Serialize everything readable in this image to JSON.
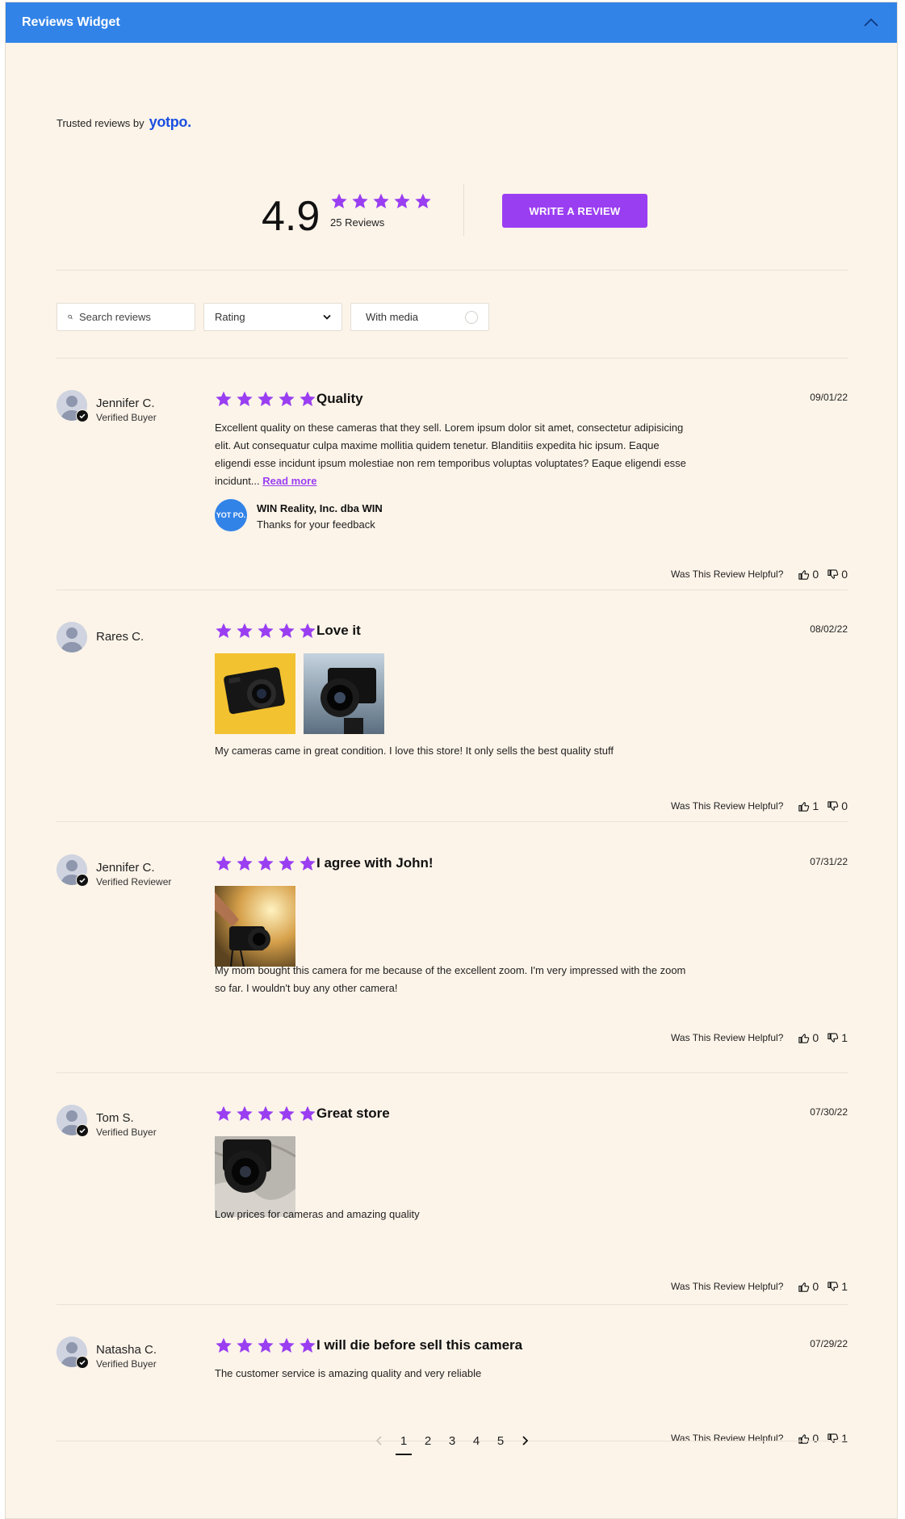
{
  "header": {
    "title": "Reviews Widget"
  },
  "branding": {
    "trusted_text": "Trusted reviews by",
    "logo_text": "yotpo."
  },
  "summary": {
    "average": "4.9",
    "count_text": "25 Reviews",
    "stars": 5,
    "write_button": "WRITE A REVIEW"
  },
  "filters": {
    "search_placeholder": "Search reviews",
    "rating_label": "Rating",
    "media_label": "With media"
  },
  "colors": {
    "header": "#3283e8",
    "accent": "#9a3ef2",
    "background": "#fdf4e9",
    "logo": "#1a4fe0"
  },
  "helpful_label": "Was This Review Helpful?",
  "reviews": [
    {
      "name": "Jennifer C.",
      "badge": "Verified Buyer",
      "title": "Quality",
      "date": "09/01/22",
      "stars": 5,
      "body": "Excellent quality on these cameras that they sell. Lorem ipsum dolor sit amet, consectetur adipisicing elit. Aut consequatur culpa maxime mollitia quidem tenetur. Blanditiis expedita hic ipsum. Eaque eligendi esse incidunt ipsum molestiae non rem temporibus voluptas voluptates? Eaque eligendi esse incidunt...",
      "read_more": "Read more",
      "reply": {
        "name": "WIN Reality, Inc. dba WIN",
        "text": "Thanks for your feedback",
        "logo": "YOT PO."
      },
      "up": "0",
      "down": "0"
    },
    {
      "name": "Rares C.",
      "badge": "",
      "title": "Love it",
      "date": "08/02/22",
      "stars": 5,
      "media": [
        "camera-on-yellow-photo",
        "lens-closeup-photo"
      ],
      "body": "My cameras came in great condition. I love this store! It only sells the best quality stuff",
      "up": "1",
      "down": "0"
    },
    {
      "name": "Jennifer C.",
      "badge": "Verified Reviewer",
      "title": "I agree with John!",
      "date": "07/31/22",
      "stars": 5,
      "media": [
        "hand-holding-camera-photo"
      ],
      "body": "My mom bought this camera for me because of the excellent zoom. I'm very impressed with the zoom so far. I wouldn't buy any other camera!",
      "up": "0",
      "down": "1"
    },
    {
      "name": "Tom S.",
      "badge": "Verified Buyer",
      "title": "Great store",
      "date": "07/30/22",
      "stars": 5,
      "media": [
        "camera-on-bed-photo"
      ],
      "body": "Low prices for cameras and amazing quality",
      "up": "0",
      "down": "1"
    },
    {
      "name": "Natasha C.",
      "badge": "Verified Buyer",
      "title": "I will die before sell this camera",
      "date": "07/29/22",
      "stars": 5,
      "body": "The customer service is amazing quality and very reliable",
      "up": "0",
      "down": "1"
    }
  ],
  "pagination": {
    "pages": [
      "1",
      "2",
      "3",
      "4",
      "5"
    ],
    "current": "1"
  }
}
